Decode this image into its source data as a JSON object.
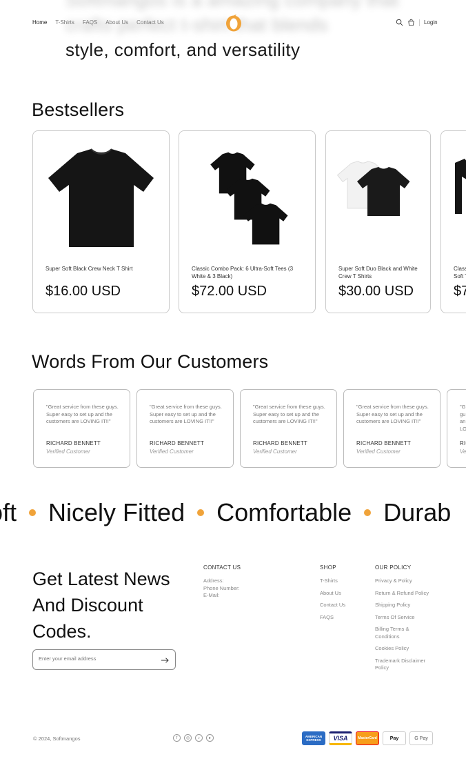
{
  "hero": {
    "blurred_text": "Softmangos is a amazing company that crafts perfect t-shirt that blends",
    "tagline": "style, comfort, and versatility"
  },
  "header": {
    "nav": [
      {
        "label": "Home",
        "active": true
      },
      {
        "label": "T-Shirts",
        "active": false
      },
      {
        "label": "FAQS",
        "active": false
      },
      {
        "label": "About Us",
        "active": false
      },
      {
        "label": "Contact Us",
        "active": false
      }
    ],
    "logo_icon": "mango-logo-icon",
    "brand_color": "#f0a33a",
    "login_label": "Login"
  },
  "bestsellers": {
    "title": "Bestsellers",
    "products": [
      {
        "name": "Super Soft Black Crew Neck T Shirt",
        "price": "$16.00 USD",
        "image": "black-tshirt"
      },
      {
        "name": "Classic Combo Pack: 6 Ultra-Soft Tees (3 White & 3 Black)",
        "price": "$72.00 USD",
        "image": "three-black-tshirts"
      },
      {
        "name": "Super Soft Duo Black and White Crew T Shirts",
        "price": "$30.00 USD",
        "image": "black-white-tshirts"
      },
      {
        "name": "Classic Soft T",
        "price": "$7",
        "image": "black-tshirt-partial"
      }
    ]
  },
  "testimonials": {
    "title": "Words From Our Customers",
    "items": [
      {
        "quote": "\"Great service from these guys. Super easy to set up and the customers are LOVING IT!!\"",
        "author": "RICHARD BENNETT",
        "role": "Verified Customer"
      },
      {
        "quote": "\"Great service from these guys. Super easy to set up and the customers are LOVING IT!!\"",
        "author": "RICHARD BENNETT",
        "role": "Verified Customer"
      },
      {
        "quote": "\"Great service from these guys. Super easy to set up and the customers are LOVING IT!!\"",
        "author": "RICHARD BENNETT",
        "role": "Verified Customer"
      },
      {
        "quote": "\"Great service from these guys. Super easy to set up and the customers are LOVING IT!!\"",
        "author": "RICHARD BENNETT",
        "role": "Verified Customer"
      },
      {
        "quote": "\"Gr gu an LO",
        "author": "RIC",
        "role": "Ver"
      }
    ]
  },
  "marquee": {
    "words": [
      "oft",
      "Nicely Fitted",
      "Comfortable",
      "Durab"
    ],
    "dot_color": "#f0a33a"
  },
  "newsletter": {
    "title": "Get Latest News And Discount Codes.",
    "email_placeholder": "Enter your email address"
  },
  "footer": {
    "contact": {
      "heading": "CONTACT US",
      "lines": [
        "Address:",
        "Phone Number:",
        "E-Mail:"
      ]
    },
    "shop": {
      "heading": "SHOP",
      "links": [
        "T-Shirts",
        "About Us",
        "Contact Us",
        "FAQS"
      ]
    },
    "policy": {
      "heading": "OUR POLICY",
      "links": [
        "Privacy & Policy",
        "Return & Refund Policy",
        "Shipping Policy",
        "Terms Of Service",
        "Billing Terms & Conditions",
        "Cookies Policy",
        "Trademark Disclaimer Policy"
      ]
    },
    "copyright": "© 2024, Softmangos",
    "socials": [
      "facebook-icon",
      "instagram-icon",
      "tiktok-icon",
      "youtube-icon"
    ],
    "payments": [
      {
        "name": "American Express",
        "label": "AMERICAN EXPRESS"
      },
      {
        "name": "Visa",
        "label": "VISA"
      },
      {
        "name": "Mastercard",
        "label": "MasterCard"
      },
      {
        "name": "Apple Pay",
        "label": "Pay"
      },
      {
        "name": "Google Pay",
        "label": "G Pay"
      }
    ]
  }
}
